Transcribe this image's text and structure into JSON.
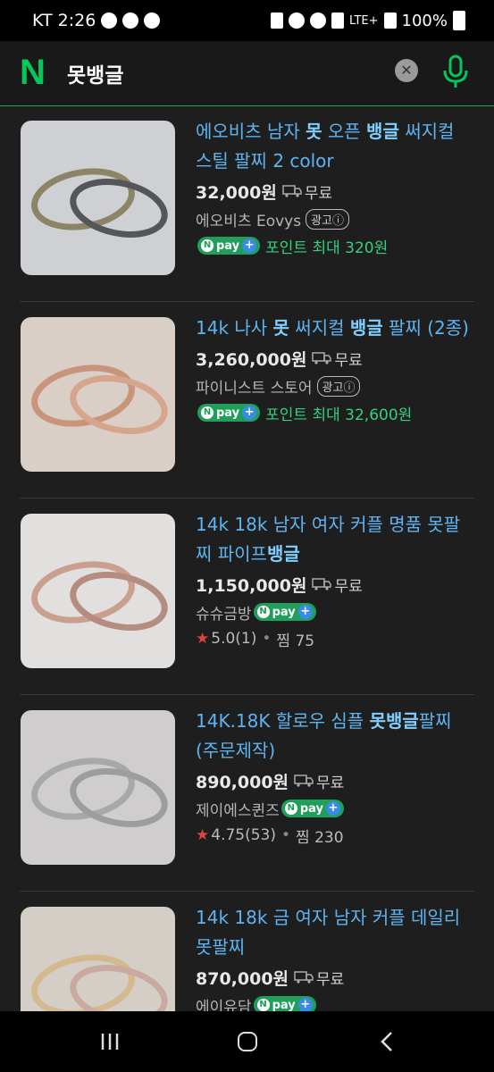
{
  "status_bar": {
    "carrier_time": "KT 2:26",
    "network": "LTE+",
    "battery": "100%"
  },
  "search": {
    "query": "못뱅글",
    "logo": "N"
  },
  "results": [
    {
      "title_parts": [
        {
          "t": "에오비츠 남자 ",
          "b": false
        },
        {
          "t": "못",
          "b": true
        },
        {
          "t": " 오픈 ",
          "b": false
        },
        {
          "t": "뱅글",
          "b": true
        },
        {
          "t": " 써지컬 스틸 팔찌 2 color",
          "b": false
        }
      ],
      "price": "32,000원",
      "shipping": "무료",
      "seller": "에오비츠 Eovys",
      "ad_label": "광고ⓘ",
      "npay": true,
      "points": "포인트 최대 320원"
    },
    {
      "title_parts": [
        {
          "t": "14k 나사 ",
          "b": false
        },
        {
          "t": "못",
          "b": true
        },
        {
          "t": " 써지컬 ",
          "b": false
        },
        {
          "t": "뱅글",
          "b": true
        },
        {
          "t": " 팔찌 (2종)",
          "b": false
        }
      ],
      "price": "3,260,000원",
      "shipping": "무료",
      "seller": "파이니스트 스토어",
      "ad_label": "광고ⓘ",
      "npay": true,
      "points": "포인트 최대 32,600원"
    },
    {
      "title_parts": [
        {
          "t": "14k 18k 남자 여자 커플 명품 못팔찌 파이프",
          "b": false
        },
        {
          "t": "뱅글",
          "b": true
        }
      ],
      "price": "1,150,000원",
      "shipping": "무료",
      "seller": "슈슈금방",
      "npay": true,
      "rating": "5.0(1)",
      "wish": "찜 75"
    },
    {
      "title_parts": [
        {
          "t": "14K.18K 할로우 심플 ",
          "b": false
        },
        {
          "t": "못뱅글",
          "b": true
        },
        {
          "t": "팔찌(주문제작)",
          "b": false
        }
      ],
      "price": "890,000원",
      "shipping": "무료",
      "seller": "제이에스퀸즈",
      "npay": true,
      "rating": "4.75(53)",
      "wish": "찜 230"
    },
    {
      "title_parts": [
        {
          "t": "14k 18k 금 여자 남자 커플 데일리 못팔찌",
          "b": false
        }
      ],
      "price": "870,000원",
      "shipping": "무료",
      "seller": "에이유담",
      "npay": true
    }
  ],
  "npay_label": "pay",
  "colors": {
    "accent_green": "#03c75a",
    "title_blue": "#5db4f0",
    "points_green": "#35d07f"
  }
}
